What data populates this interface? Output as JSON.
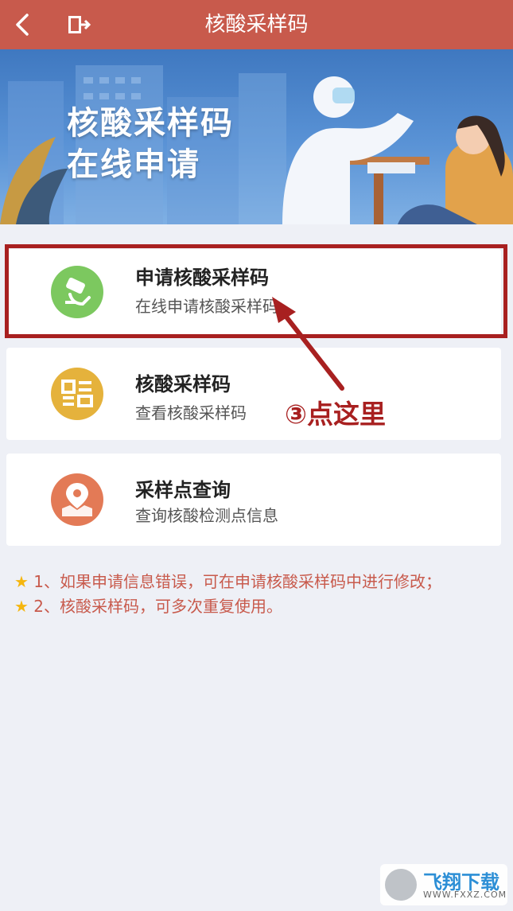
{
  "header": {
    "title": "核酸采样码",
    "back_icon": "chevron-left-icon",
    "exit_icon": "exit-door-icon",
    "bg_color": "#c85a4c"
  },
  "banner": {
    "line1": "核酸采样码",
    "line2": "在线申请"
  },
  "menu": [
    {
      "title": "申请核酸采样码",
      "subtitle": "在线申请核酸采样码",
      "icon": "swab-icon",
      "icon_color": "#7cc85f"
    },
    {
      "title": "核酸采样码",
      "subtitle": "查看核酸采样码",
      "icon": "qr-code-icon",
      "icon_color": "#e5b23c"
    },
    {
      "title": "采样点查询",
      "subtitle": "查询核酸检测点信息",
      "icon": "map-pin-icon",
      "icon_color": "#e37a56"
    }
  ],
  "annotation": {
    "text": "③点这里",
    "color": "#a82020"
  },
  "notes": [
    "1、如果申请信息错误，可在申请核酸采样码中进行修改；",
    "2、核酸采样码，可多次重复使用。"
  ],
  "watermark": {
    "brand": "飞翔下载",
    "url": "WWW.FXXZ.COM"
  }
}
